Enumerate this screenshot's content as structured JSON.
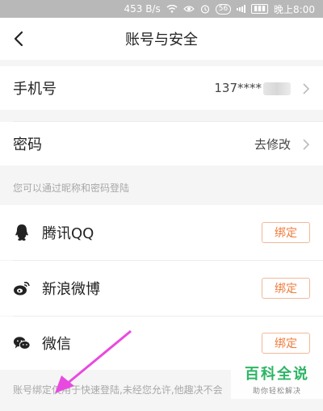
{
  "status_bar": {
    "speed": "453 B/s",
    "network": "56",
    "time": "晚上8:00"
  },
  "header": {
    "title": "账号与安全"
  },
  "account": {
    "phone_label": "手机号",
    "phone_value": "137****",
    "password_label": "密码",
    "password_action": "去修改"
  },
  "login_hint": "您可以通过昵称和密码登陆",
  "bindings": [
    {
      "label": "腾讯QQ",
      "icon": "qq-icon",
      "button": "绑定"
    },
    {
      "label": "新浪微博",
      "icon": "weibo-icon",
      "button": "绑定"
    },
    {
      "label": "微信",
      "icon": "wechat-icon",
      "button": "绑定"
    }
  ],
  "footer_hint": "账号绑定仅用于快速登陆,未经您允许,他趣决不会",
  "watermark": {
    "title": "百科全说",
    "subtitle": "助你轻松解决"
  },
  "colors": {
    "accent": "#ef7b3d",
    "annotation_arrow": "#e84ae0",
    "watermark_green": "#2cb564"
  }
}
